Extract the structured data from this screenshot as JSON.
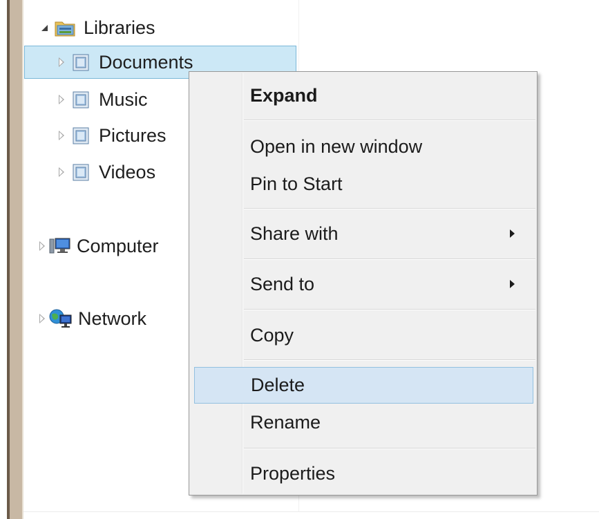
{
  "nav_tree": {
    "libraries": {
      "label": "Libraries",
      "icon": "libraries-folder-icon",
      "expanded": true
    },
    "library_items": [
      {
        "label": "Documents",
        "icon": "library-icon",
        "selected": true
      },
      {
        "label": "Music",
        "icon": "library-icon",
        "selected": false
      },
      {
        "label": "Pictures",
        "icon": "library-icon",
        "selected": false
      },
      {
        "label": "Videos",
        "icon": "library-icon",
        "selected": false
      }
    ],
    "computer": {
      "label": "Computer",
      "icon": "computer-icon"
    },
    "network": {
      "label": "Network",
      "icon": "network-icon"
    }
  },
  "context_menu": {
    "items": [
      {
        "label": "Expand",
        "bold": true
      },
      {
        "label": "Open in new window"
      },
      {
        "label": "Pin to Start"
      },
      {
        "label": "Share with",
        "submenu": true
      },
      {
        "label": "Send to",
        "submenu": true
      },
      {
        "label": "Copy"
      },
      {
        "label": "Delete",
        "highlighted": true
      },
      {
        "label": "Rename"
      },
      {
        "label": "Properties"
      }
    ]
  },
  "colors": {
    "selection_bg": "#cce8f6",
    "selection_border": "#7ab7d8",
    "menu_bg": "#f0f0f0",
    "menu_hover_bg": "#d5e5f4",
    "menu_hover_border": "#92c0e0"
  }
}
